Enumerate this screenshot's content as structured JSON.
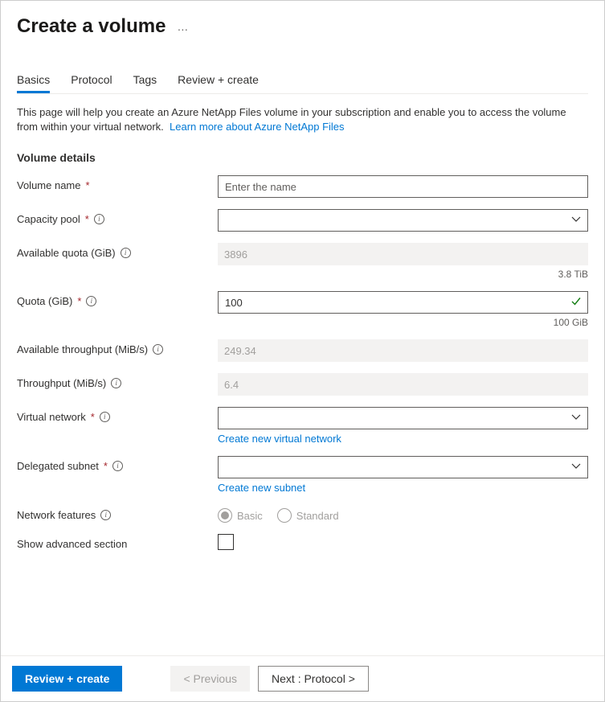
{
  "header": {
    "title": "Create a volume",
    "more": "…"
  },
  "tabs": {
    "basics": "Basics",
    "protocol": "Protocol",
    "tags": "Tags",
    "review": "Review + create"
  },
  "intro": {
    "text": "This page will help you create an Azure NetApp Files volume in your subscription and enable you to access the volume from within your virtual network.",
    "linkText": "Learn more about Azure NetApp Files"
  },
  "section": {
    "volumeDetails": "Volume details"
  },
  "fields": {
    "volumeName": {
      "label": "Volume name",
      "placeholder": "Enter the name",
      "value": ""
    },
    "capacityPool": {
      "label": "Capacity pool",
      "value": ""
    },
    "availableQuota": {
      "label": "Available quota (GiB)",
      "value": "3896",
      "hint": "3.8 TiB"
    },
    "quota": {
      "label": "Quota (GiB)",
      "value": "100",
      "hint": "100 GiB"
    },
    "availableThroughput": {
      "label": "Available throughput (MiB/s)",
      "value": "249.34"
    },
    "throughput": {
      "label": "Throughput (MiB/s)",
      "value": "6.4"
    },
    "virtualNetwork": {
      "label": "Virtual network",
      "value": "",
      "createLink": "Create new virtual network"
    },
    "delegatedSubnet": {
      "label": "Delegated subnet",
      "value": "",
      "createLink": "Create new subnet"
    },
    "networkFeatures": {
      "label": "Network features",
      "basic": "Basic",
      "standard": "Standard"
    },
    "showAdvanced": {
      "label": "Show advanced section"
    }
  },
  "footer": {
    "reviewCreate": "Review + create",
    "previous": "< Previous",
    "next": "Next : Protocol >"
  }
}
